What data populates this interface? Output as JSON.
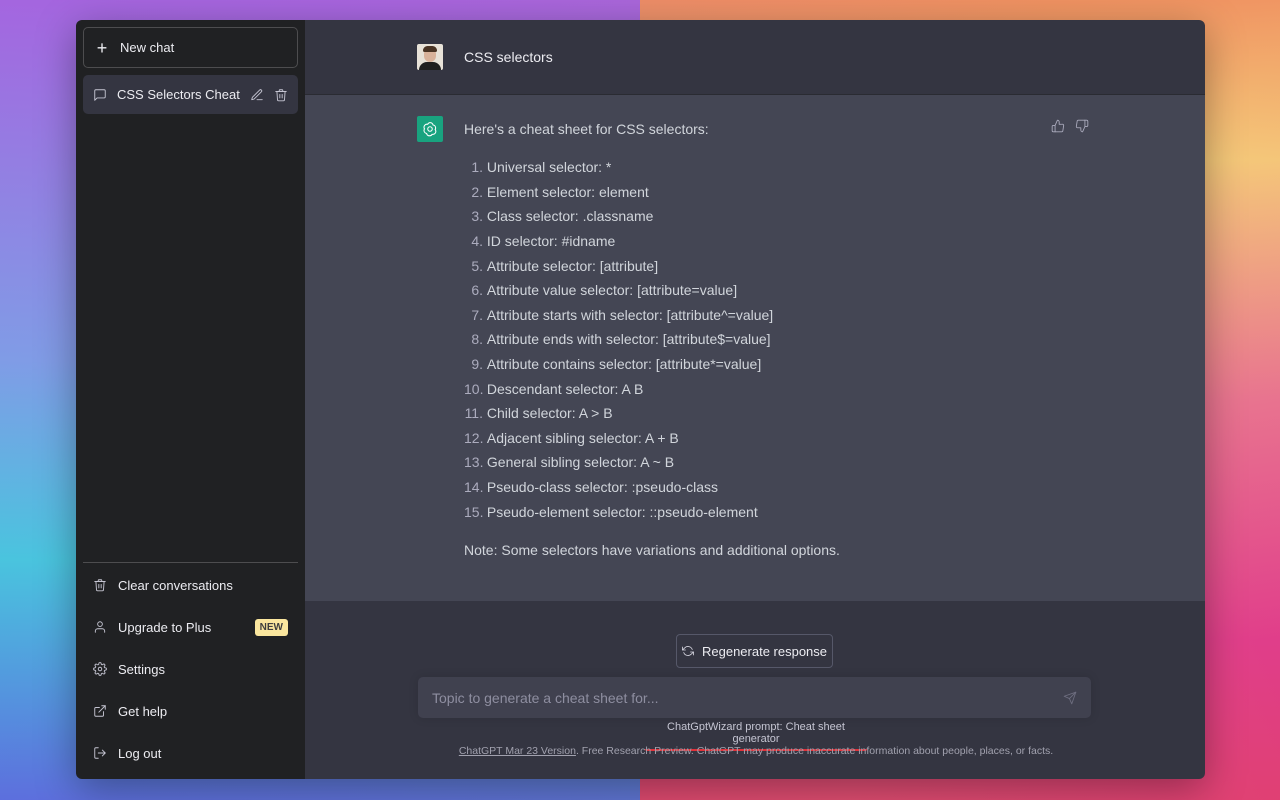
{
  "sidebar": {
    "new_chat_label": "New chat",
    "conversation_title": "CSS Selectors Cheat Sh",
    "links": {
      "clear": "Clear conversations",
      "upgrade": "Upgrade to Plus",
      "upgrade_badge": "NEW",
      "settings": "Settings",
      "help": "Get help",
      "logout": "Log out"
    }
  },
  "conversation": {
    "user_message": "CSS selectors",
    "assistant_intro": "Here's a cheat sheet for CSS selectors:",
    "items": [
      {
        "num": "1.",
        "text": "Universal selector: *"
      },
      {
        "num": "2.",
        "text": "Element selector: element"
      },
      {
        "num": "3.",
        "text": "Class selector: .classname"
      },
      {
        "num": "4.",
        "text": "ID selector: #idname"
      },
      {
        "num": "5.",
        "text": "Attribute selector: [attribute]"
      },
      {
        "num": "6.",
        "text": "Attribute value selector: [attribute=value]"
      },
      {
        "num": "7.",
        "text": "Attribute starts with selector: [attribute^=value]"
      },
      {
        "num": "8.",
        "text": "Attribute ends with selector: [attribute$=value]"
      },
      {
        "num": "9.",
        "text": "Attribute contains selector: [attribute*=value]"
      },
      {
        "num": "10.",
        "text": "Descendant selector: A B"
      },
      {
        "num": "11.",
        "text": "Child selector: A > B"
      },
      {
        "num": "12.",
        "text": "Adjacent sibling selector: A + B"
      },
      {
        "num": "13.",
        "text": "General sibling selector: A ~ B"
      },
      {
        "num": "14.",
        "text": "Pseudo-class selector: :pseudo-class"
      },
      {
        "num": "15.",
        "text": "Pseudo-element selector: ::pseudo-element"
      }
    ],
    "note": "Note: Some selectors have variations and additional options."
  },
  "composer": {
    "regenerate_label": "Regenerate response",
    "placeholder": "Topic to generate a cheat sheet for...",
    "wizard_label": "ChatGptWizard prompt: Cheat sheet generator",
    "footer_link": "ChatGPT Mar 23 Version",
    "footer_text": ". Free Research Preview. ChatGPT may produce inaccurate information about people, places, or facts."
  },
  "colors": {
    "sidebar_bg": "#202123",
    "main_bg": "#343541",
    "assistant_bg": "#444654",
    "gpt_green": "#19a37f",
    "badge_yellow": "#fae69e",
    "underline_red": "#e0323a"
  }
}
